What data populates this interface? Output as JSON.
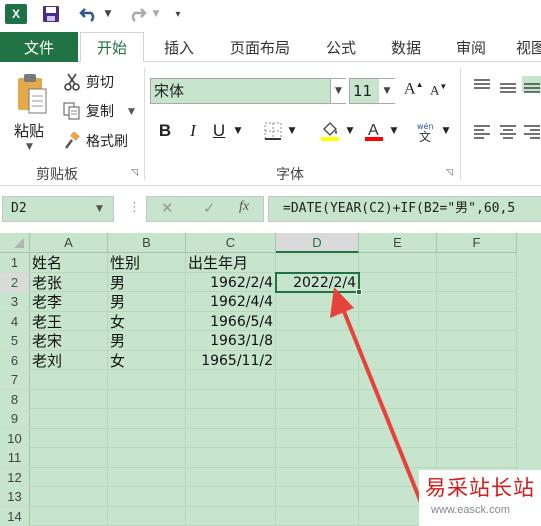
{
  "tabs": {
    "file": "文件",
    "home": "开始",
    "insert": "插入",
    "page_layout": "页面布局",
    "formulas": "公式",
    "data": "数据",
    "review": "审阅",
    "view": "视图"
  },
  "ribbon": {
    "clipboard": {
      "paste": "粘贴",
      "cut": "剪切",
      "copy": "复制",
      "format_painter": "格式刷",
      "group_label": "剪贴板"
    },
    "font": {
      "font_name": "宋体",
      "font_size": "11",
      "bold": "B",
      "italic": "I",
      "underline": "U",
      "grow": "A",
      "shrink": "A",
      "group_label": "字体"
    },
    "colors": {
      "fill": "#ffff00",
      "font": "#ff0000"
    }
  },
  "formula_bar": {
    "name_box": "D2",
    "fx": "fx",
    "formula": "=DATE(YEAR(C2)+IF(B2=\"男\",60,5"
  },
  "sheet": {
    "columns": [
      "A",
      "B",
      "C",
      "D",
      "E",
      "F"
    ],
    "active_column": "D",
    "active_row": "2",
    "rows": [
      "1",
      "2",
      "3",
      "4",
      "5",
      "6",
      "7",
      "8",
      "9",
      "10",
      "11",
      "12",
      "13",
      "14"
    ],
    "cells": {
      "A1": "姓名",
      "B1": "性别",
      "C1": "出生年月",
      "A2": "老张",
      "B2": "男",
      "C2": "1962/2/4",
      "D2": "2022/2/4",
      "A3": "老李",
      "B3": "男",
      "C3": "1962/4/4",
      "A4": "老王",
      "B4": "女",
      "C4": "1966/5/4",
      "A5": "老宋",
      "B5": "男",
      "C5": "1963/1/8",
      "A6": "老刘",
      "B6": "女",
      "C6": "1965/11/2"
    }
  },
  "watermark": {
    "title": "易采站长站",
    "url": "www.easck.com"
  },
  "theme": {
    "excel_green": "#217346",
    "eye_care_bg": "#c6e5cc",
    "arrow": "#e8433a"
  }
}
